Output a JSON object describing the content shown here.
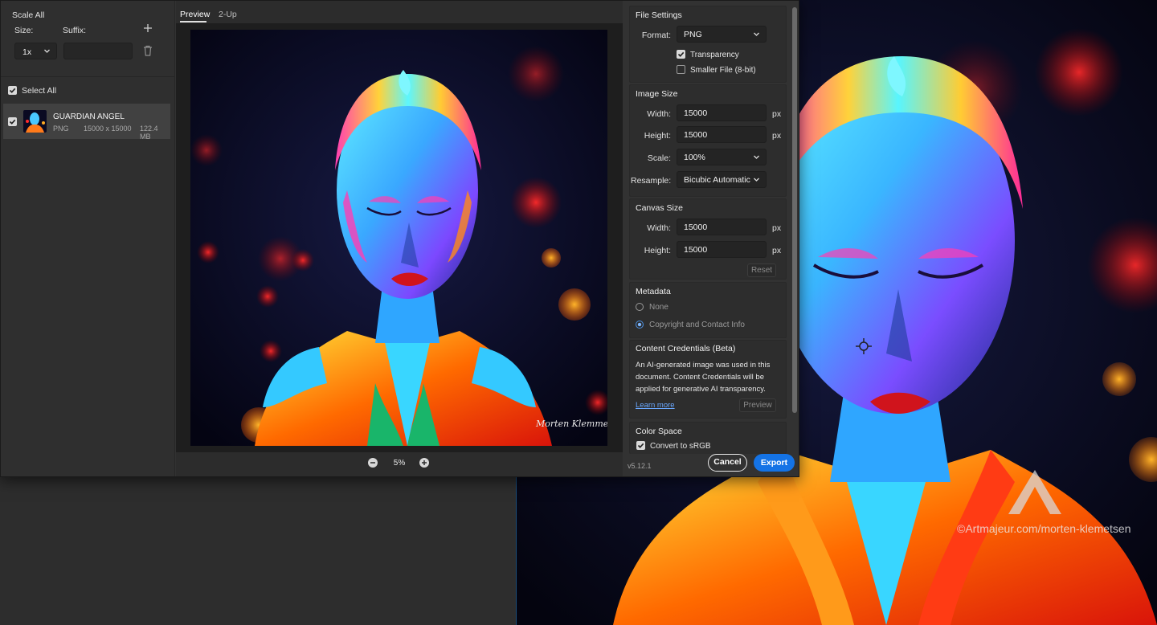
{
  "left_panel": {
    "scale_all_label": "Scale All",
    "size_label": "Size:",
    "suffix_label": "Suffix:",
    "size_value": "1x",
    "suffix_value": "",
    "select_all_label": "Select All",
    "asset": {
      "name": "GUARDIAN ANGEL",
      "format": "PNG",
      "dimensions": "15000 x 15000",
      "filesize": "122.4 MB"
    }
  },
  "preview": {
    "tabs": [
      "Preview",
      "2-Up"
    ],
    "zoom": "5%",
    "signature": "Morten Klemmetsen"
  },
  "file_settings": {
    "title": "File Settings",
    "format_label": "Format:",
    "format_value": "PNG",
    "transparency_label": "Transparency",
    "smaller_file_label": "Smaller File (8-bit)"
  },
  "image_size": {
    "title": "Image Size",
    "width_label": "Width:",
    "width_value": "15000",
    "height_label": "Height:",
    "height_value": "15000",
    "scale_label": "Scale:",
    "scale_value": "100%",
    "resample_label": "Resample:",
    "resample_value": "Bicubic Automatic",
    "unit": "px"
  },
  "canvas_size": {
    "title": "Canvas Size",
    "width_label": "Width:",
    "width_value": "15000",
    "height_label": "Height:",
    "height_value": "15000",
    "unit": "px",
    "reset_label": "Reset"
  },
  "metadata": {
    "title": "Metadata",
    "option_none": "None",
    "option_copyright": "Copyright and Contact Info"
  },
  "content_credentials": {
    "title": "Content Credentials (Beta)",
    "line1": "An AI-generated image was used in this",
    "line2": "document. Content Credentials will be",
    "line3": "applied for generative AI transparency.",
    "learn_more": "Learn more",
    "preview_button": "Preview"
  },
  "color_space": {
    "title": "Color Space",
    "convert_label": "Convert to sRGB"
  },
  "footer": {
    "version": "v5.12.1",
    "cancel": "Cancel",
    "export": "Export"
  },
  "watermark": {
    "text": "©Artmajeur.com/morten-klemetsen"
  },
  "colors": {
    "accent": "#1473e6",
    "dialog_bg": "#323232"
  }
}
